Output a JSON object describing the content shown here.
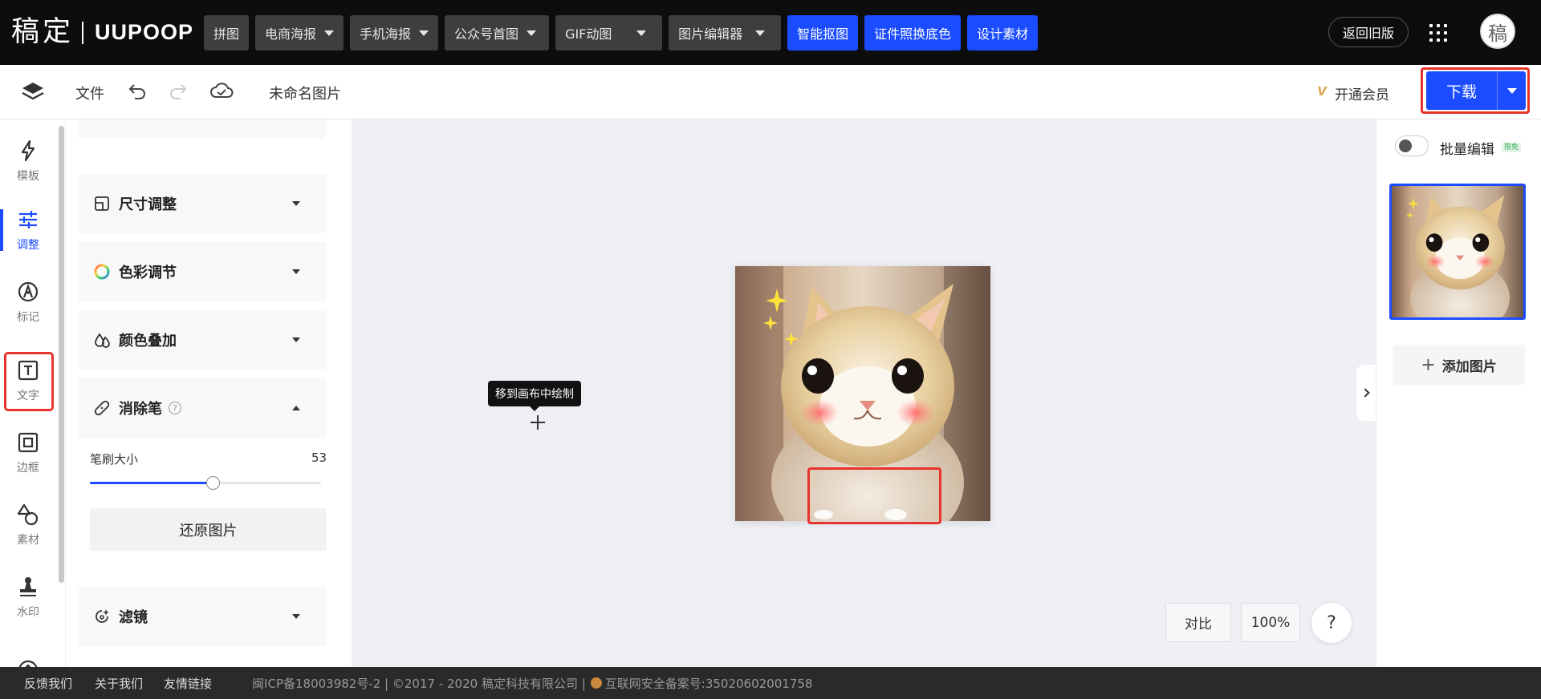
{
  "logo": {
    "cn": "稿定",
    "en": "UUPOOP"
  },
  "nav": [
    {
      "label": "拼图",
      "dropdown": false,
      "style": "dark"
    },
    {
      "label": "电商海报",
      "dropdown": true,
      "style": "dark"
    },
    {
      "label": "手机海报",
      "dropdown": true,
      "style": "dark"
    },
    {
      "label": "公众号首图",
      "dropdown": true,
      "style": "dark"
    },
    {
      "label": "GIF动图",
      "dropdown": true,
      "style": "dark"
    },
    {
      "label": "图片编辑器",
      "dropdown": true,
      "style": "dark"
    },
    {
      "label": "智能抠图",
      "dropdown": false,
      "style": "blue"
    },
    {
      "label": "证件照换底色",
      "dropdown": false,
      "style": "blue"
    },
    {
      "label": "设计素材",
      "dropdown": false,
      "style": "blue"
    }
  ],
  "header": {
    "back_old": "返回旧版",
    "avatar_text": "稿"
  },
  "toolbar": {
    "file": "文件",
    "doc_title": "未命名图片",
    "vip_icon": "V",
    "vip": "开通会员",
    "download": "下载"
  },
  "rail": [
    {
      "label": "模板",
      "icon": "lightning-icon"
    },
    {
      "label": "调整",
      "icon": "sliders-icon",
      "active": true
    },
    {
      "label": "标记",
      "icon": "pen-icon"
    },
    {
      "label": "文字",
      "icon": "text-icon"
    },
    {
      "label": "边框",
      "icon": "frame-icon"
    },
    {
      "label": "素材",
      "icon": "shapes-icon"
    },
    {
      "label": "水印",
      "icon": "stamp-icon"
    }
  ],
  "panel": {
    "sections": [
      {
        "title": "尺寸调整",
        "icon": "crop-icon"
      },
      {
        "title": "色彩调节",
        "icon": "color-wheel-icon"
      },
      {
        "title": "颜色叠加",
        "icon": "drops-icon"
      },
      {
        "title": "消除笔",
        "icon": "bandage-icon",
        "expanded": true
      },
      {
        "title": "滤镜",
        "icon": "filter-icon"
      }
    ],
    "brush_label": "笔刷大小",
    "brush_value": "53",
    "brush_fraction": 0.53,
    "restore": "还原图片"
  },
  "canvas": {
    "tooltip": "移到画布中绘制",
    "compare": "对比",
    "zoom": "100%",
    "help": "?"
  },
  "right": {
    "batch": "批量编辑",
    "badge": "限免",
    "add_image": "添加图片"
  },
  "footer": {
    "links": [
      "反馈我们",
      "关于我们",
      "友情链接"
    ],
    "icp": "闽ICP备18003982号-2 | ©2017 - 2020 稿定科技有限公司 |",
    "police": "互联网安全备案号:35020602001758"
  },
  "colors": {
    "accent": "#1b4cff",
    "highlight": "#e8322c",
    "topbar": "#0d0d0d"
  }
}
